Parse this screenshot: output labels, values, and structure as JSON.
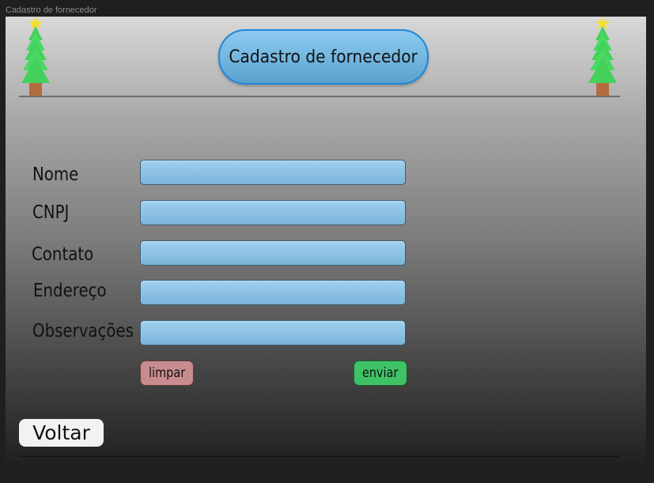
{
  "window": {
    "title": "Cadastro de fornecedor"
  },
  "header": {
    "title": "Cadastro de fornecedor",
    "decoration_icon": "christmas-tree-icon"
  },
  "form": {
    "fields": [
      {
        "label": "Nome",
        "value": "",
        "placeholder": ""
      },
      {
        "label": "CNPJ",
        "value": "",
        "placeholder": ""
      },
      {
        "label": "Contato",
        "value": "",
        "placeholder": ""
      },
      {
        "label": "Endereço",
        "value": "",
        "placeholder": ""
      },
      {
        "label": "Observações",
        "value": "",
        "placeholder": ""
      }
    ],
    "clear_label": "limpar",
    "send_label": "enviar"
  },
  "footer": {
    "back_label": "Voltar"
  },
  "colors": {
    "title_border": "#1f86d8",
    "field_fill": "#8bc1e3",
    "clear_button": "#c88c8f",
    "send_button": "#3fc266",
    "back_button": "#f2f2f2"
  }
}
